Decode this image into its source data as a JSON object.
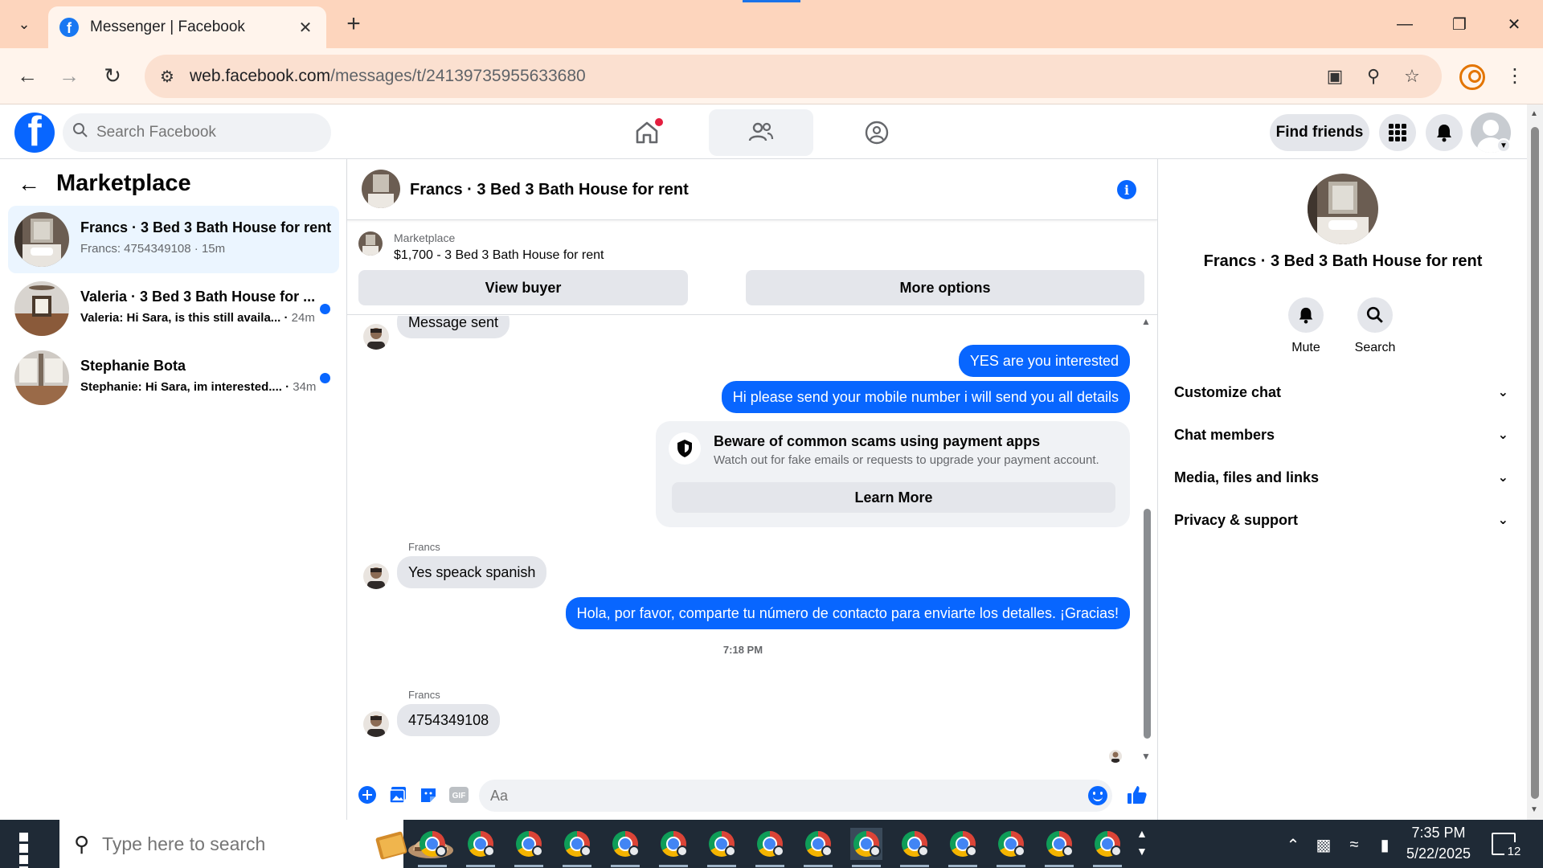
{
  "browser": {
    "tab_title": "Messenger | Facebook",
    "url_host": "web.facebook.com",
    "url_path": "/messages/t/24139735955633680"
  },
  "fb_header": {
    "search_placeholder": "Search Facebook",
    "find_friends_label": "Find friends"
  },
  "left": {
    "title": "Marketplace",
    "conversations": [
      {
        "title": "Francs · 3 Bed 3 Bath House for rent",
        "preview": "Francs: 4754349108",
        "time": "15m",
        "unread": false,
        "active": true
      },
      {
        "title": "Valeria · 3 Bed 3 Bath House for ...",
        "preview": "Valeria: Hi Sara, is this still availa...",
        "time": "24m",
        "unread": true,
        "active": false
      },
      {
        "title": "Stephanie Bota",
        "preview": "Stephanie: Hi Sara, im interested....",
        "time": "34m",
        "unread": true,
        "active": false
      }
    ]
  },
  "chat": {
    "title": "Francs · 3 Bed 3 Bath House for rent",
    "marketplace_label": "Marketplace",
    "listing": "$1,700 - 3 Bed 3 Bath House for rent",
    "view_buyer_label": "View buyer",
    "more_options_label": "More options",
    "messages": {
      "m0": "Message sent",
      "m1": "YES are you interested",
      "m2": "Hi please send your mobile number  i will send you all details",
      "sender_1": "Francs",
      "m3": "Yes speack spanish",
      "m4": "Hola, por favor, comparte tu número de contacto para enviarte los detalles. ¡Gracias!",
      "timestamp": "7:18 PM",
      "sender_2": "Francs",
      "m5": "4754349108"
    },
    "scam_notice": {
      "title": "Beware of common scams using payment apps",
      "subtitle": "Watch out for fake emails or requests to upgrade your payment account.",
      "button": "Learn More"
    },
    "composer_placeholder": "Aa"
  },
  "info_panel": {
    "name": "Francs · 3 Bed 3 Bath House for rent",
    "mute_label": "Mute",
    "search_label": "Search",
    "rows": [
      "Customize chat",
      "Chat members",
      "Media, files and links",
      "Privacy & support"
    ]
  },
  "taskbar": {
    "search_placeholder": "Type here to search",
    "time": "7:35 PM",
    "date": "5/22/2025",
    "notification_count": "12"
  },
  "colors": {
    "accent": "#0866ff",
    "tabbar": "#fdd5bd",
    "taskbar": "#1f2a36"
  }
}
